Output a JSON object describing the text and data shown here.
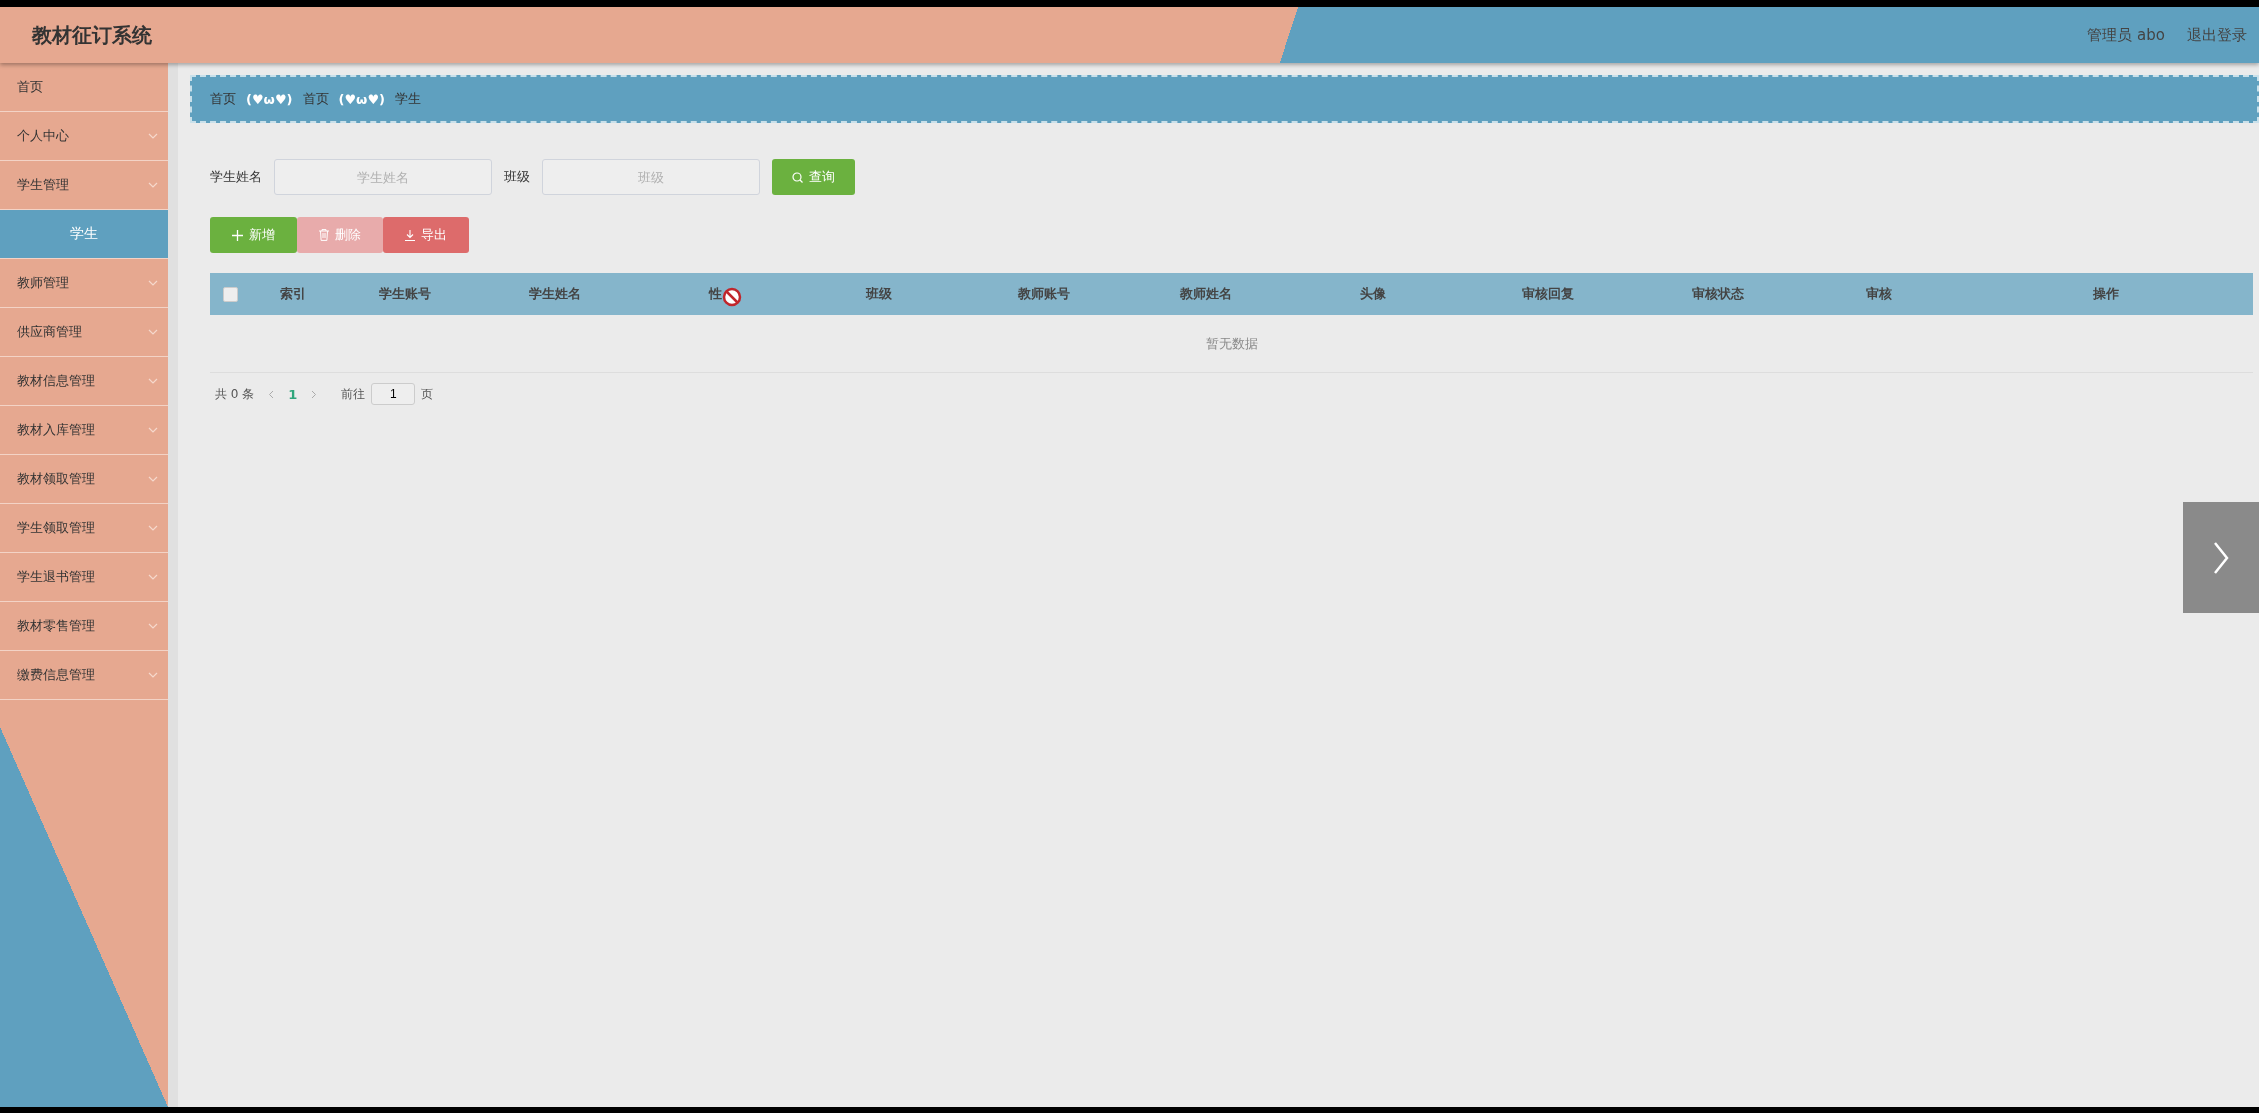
{
  "header": {
    "title": "教材征订系统",
    "user": "管理员 abo",
    "logout": "退出登录"
  },
  "sidebar": {
    "items": [
      {
        "label": "首页",
        "kind": "link"
      },
      {
        "label": "个人中心",
        "kind": "menu"
      },
      {
        "label": "学生管理",
        "kind": "menu",
        "children": [
          {
            "label": "学生",
            "selected": true
          }
        ]
      },
      {
        "label": "教师管理",
        "kind": "menu"
      },
      {
        "label": "供应商管理",
        "kind": "menu"
      },
      {
        "label": "教材信息管理",
        "kind": "menu"
      },
      {
        "label": "教材入库管理",
        "kind": "menu"
      },
      {
        "label": "教材领取管理",
        "kind": "menu"
      },
      {
        "label": "学生领取管理",
        "kind": "menu"
      },
      {
        "label": "学生退书管理",
        "kind": "menu"
      },
      {
        "label": "教材零售管理",
        "kind": "menu"
      },
      {
        "label": "缴费信息管理",
        "kind": "menu"
      }
    ]
  },
  "breadcrumb": {
    "items": [
      {
        "label": "首页",
        "separator": "(♥ω♥)"
      },
      {
        "label": "首页",
        "separator": "(♥ω♥)"
      },
      {
        "label": "学生"
      }
    ]
  },
  "search": {
    "fields": [
      {
        "label": "学生姓名",
        "placeholder": "学生姓名"
      },
      {
        "label": "班级",
        "placeholder": "班级"
      }
    ],
    "button": "查询"
  },
  "actions": [
    {
      "label": "新增",
      "kind": "add",
      "disabled": false
    },
    {
      "label": "删除",
      "kind": "delete",
      "disabled": true
    },
    {
      "label": "导出",
      "kind": "export",
      "disabled": false
    }
  ],
  "table": {
    "select_all": {
      "checked": false
    },
    "columns": [
      "索引",
      "学生账号",
      "学生姓名",
      "性",
      "班级",
      "教师账号",
      "教师姓名",
      "头像",
      "审核回复",
      "审核状态",
      "审核",
      "操作"
    ],
    "empty_text": "暂无数据"
  },
  "pagination": {
    "total": "共 0 条",
    "pages": [
      {
        "label": "1",
        "selected": true
      }
    ],
    "goto_label": "前往",
    "goto_value": "1",
    "goto_suffix": "页"
  }
}
